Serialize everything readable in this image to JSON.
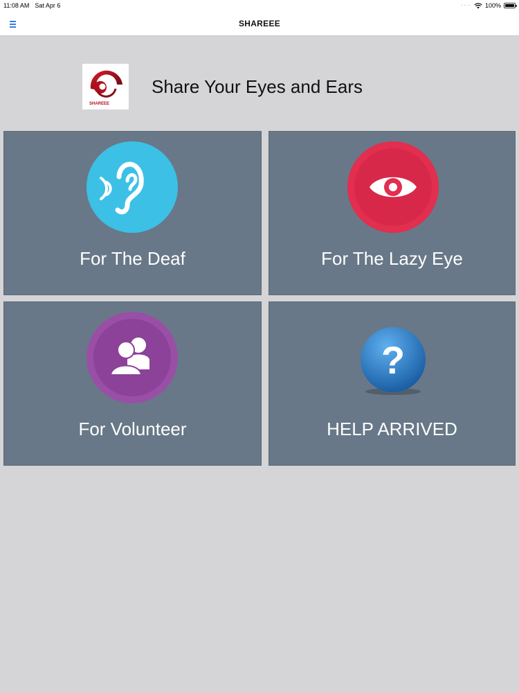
{
  "status_bar": {
    "time": "11:08 AM",
    "date": "Sat Apr 6",
    "battery": "100%",
    "battery_level": 1.0
  },
  "nav": {
    "title": "SHAREEE",
    "menu_icon": "hamburger-icon"
  },
  "brand": {
    "logo_text": "SHAREEE",
    "tagline": "Share Your Eyes and Ears"
  },
  "tiles": [
    {
      "label": "For The Deaf",
      "icon": "ear-icon",
      "color": "#3cc0e6"
    },
    {
      "label": "For The Lazy Eye",
      "icon": "eye-icon",
      "color": "#e22e4f"
    },
    {
      "label": "For Volunteer",
      "icon": "users-icon",
      "color": "#9a4fa6"
    },
    {
      "label": "HELP ARRIVED",
      "icon": "question-icon",
      "color": "#2a7cc0"
    }
  ],
  "colors": {
    "background": "#d5d4d6",
    "tile": "#687888",
    "accent": "#3a7be0"
  }
}
